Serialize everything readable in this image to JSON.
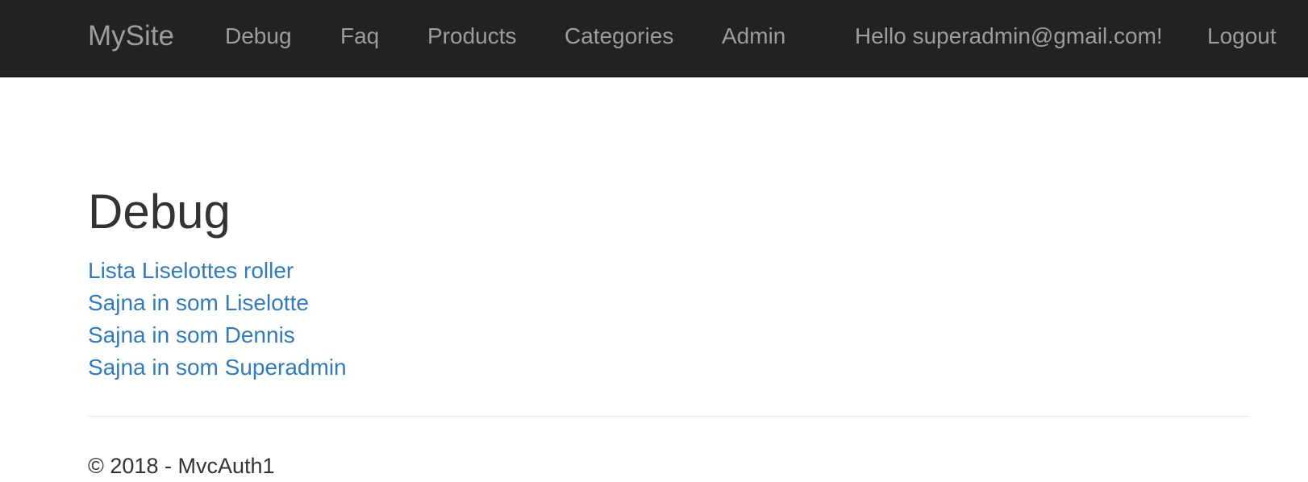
{
  "navbar": {
    "brand": "MySite",
    "links": [
      {
        "label": "Debug"
      },
      {
        "label": "Faq"
      },
      {
        "label": "Products"
      },
      {
        "label": "Categories"
      },
      {
        "label": "Admin"
      }
    ],
    "greeting": "Hello superadmin@gmail.com!",
    "logout": "Logout",
    "background_color": "#222222",
    "link_color": "#9d9d9d"
  },
  "main": {
    "title": "Debug",
    "links": [
      {
        "label": "Lista Liselottes roller"
      },
      {
        "label": "Sajna in som Liselotte"
      },
      {
        "label": "Sajna in som Dennis"
      },
      {
        "label": "Sajna in som Superadmin"
      }
    ],
    "link_color": "#337ab7"
  },
  "footer": {
    "text": "© 2018 - MvcAuth1"
  }
}
